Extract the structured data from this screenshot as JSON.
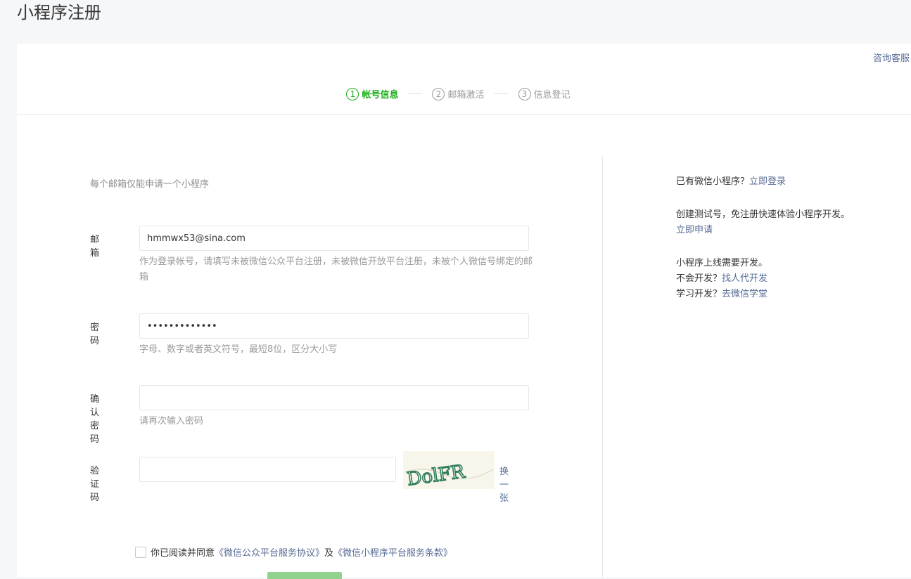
{
  "page": {
    "title": "小程序注册"
  },
  "header": {
    "help_link": "咨询客服"
  },
  "steps": [
    {
      "num": "1",
      "label": "帐号信息"
    },
    {
      "num": "2",
      "label": "邮箱激活"
    },
    {
      "num": "3",
      "label": "信息登记"
    }
  ],
  "form": {
    "tip": "每个邮箱仅能申请一个小程序",
    "email": {
      "label": "邮箱",
      "value": "hmmwx53@sina.com",
      "hint": "作为登录帐号，请填写未被微信公众平台注册，未被微信开放平台注册，未被个人微信号绑定的邮箱"
    },
    "password": {
      "label": "密码",
      "value": "•••••••••••••",
      "hint": "字母、数字或者英文符号，最短8位，区分大小写"
    },
    "confirm": {
      "label": "确认密码",
      "value": "",
      "hint": "请再次输入密码"
    },
    "captcha": {
      "label": "验证码",
      "value": "",
      "image_text": "DolFR",
      "refresh": "换一张"
    },
    "agree": {
      "prefix": "你已阅读并同意",
      "link1": "《微信公众平台服务协议》",
      "middle": "及",
      "link2": "《微信小程序平台服务条款》"
    }
  },
  "side": {
    "login_q": "已有微信小程序？",
    "login_link": "立即登录",
    "test_text": "创建测试号，免注册快速体验小程序开发。",
    "test_link": "立即申请",
    "dev_text": "小程序上线需要开发。",
    "dev_q": "不会开发？",
    "dev_link": "找人代开发",
    "learn_q": "学习开发？",
    "learn_link": "去微信学堂"
  }
}
